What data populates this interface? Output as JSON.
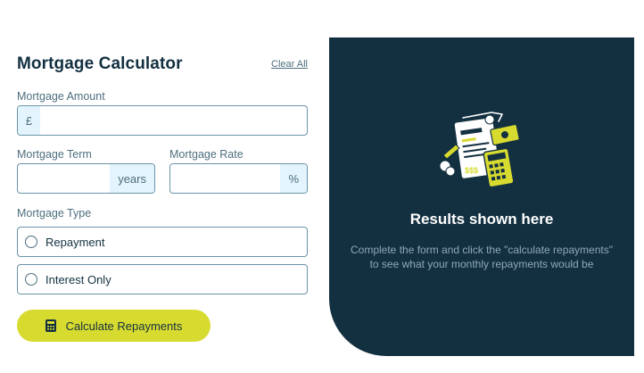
{
  "form": {
    "title": "Mortgage Calculator",
    "clear_all": "Clear All",
    "amount": {
      "label": "Mortgage Amount",
      "prefix": "£",
      "value": ""
    },
    "term": {
      "label": "Mortgage Term",
      "suffix": "years",
      "value": ""
    },
    "rate": {
      "label": "Mortgage Rate",
      "suffix": "%",
      "value": ""
    },
    "type": {
      "label": "Mortgage Type",
      "options": [
        {
          "label": "Repayment",
          "selected": false
        },
        {
          "label": "Interest Only",
          "selected": false
        }
      ]
    },
    "submit": {
      "label": "Calculate Repayments",
      "icon": "calculator-icon"
    }
  },
  "results": {
    "illustration": "empty-results-illustration",
    "title": "Results shown here",
    "text": "Complete the form and click the \"calculate repayments\" to see what your monthly repayments would be"
  },
  "colors": {
    "primary": "#133041",
    "accent_lime": "#d8db2f",
    "addon_bg": "#e3f4fc",
    "border": "#6b94a8",
    "muted_text": "#4e6e7e"
  }
}
